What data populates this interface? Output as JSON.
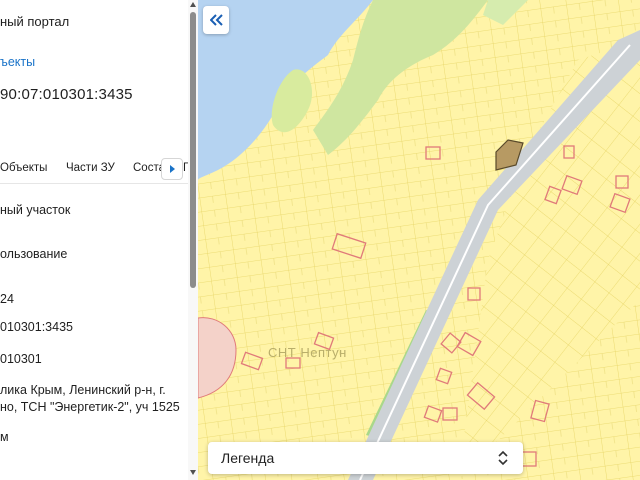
{
  "panel": {
    "portal_title": "ный портал",
    "objects_link": "ъекты",
    "cadastral_number": "90:07:010301:3435",
    "tabs": {
      "objects": "Объекты",
      "parts": "Части ЗУ",
      "more": "Соста",
      "extra": "Г"
    },
    "properties": {
      "type": "ный участок",
      "usage": "ользование",
      "area_tail": "24",
      "number": "010301:3435",
      "quarter": "010301",
      "address_line1": "лика Крым, Ленинский р-н, г.",
      "address_line2": "но, ТСН \"Энергетик-2\", уч 1525",
      "unit": "м"
    }
  },
  "map": {
    "settlement_label": "СНТ Нептун",
    "legend_label": "Легенда",
    "colors": {
      "water": "#b5d3f1",
      "parcels": "#fff4a8",
      "parcel_border": "#e3cf5a",
      "greenery": "#cfe6a0",
      "road": "#c6cbcf",
      "highlight": "#e88a8a"
    }
  }
}
